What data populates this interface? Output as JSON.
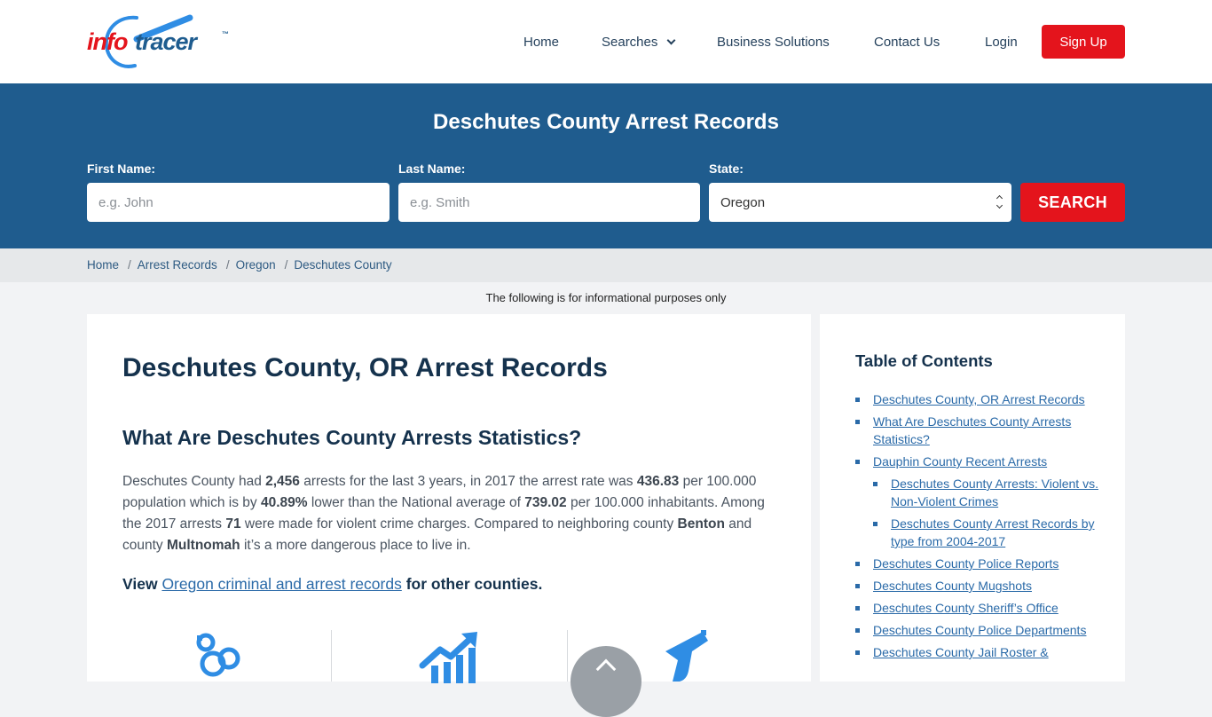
{
  "header": {
    "logo": {
      "part1": "info",
      "part2": "tracer",
      "tm": "™"
    },
    "nav": {
      "home": "Home",
      "searches": "Searches",
      "business": "Business Solutions",
      "contact": "Contact Us",
      "login": "Login",
      "signup": "Sign Up"
    }
  },
  "hero": {
    "title": "Deschutes County Arrest Records",
    "first_name_label": "First Name:",
    "first_name_placeholder": "e.g. John",
    "last_name_label": "Last Name:",
    "last_name_placeholder": "e.g. Smith",
    "state_label": "State:",
    "state_value": "Oregon",
    "search_button": "SEARCH"
  },
  "breadcrumb": [
    "Home",
    "Arrest Records",
    "Oregon",
    "Deschutes County"
  ],
  "info_note": "The following is for informational purposes only",
  "main": {
    "h1": "Deschutes County, OR Arrest Records",
    "h2": "What Are Deschutes County Arrests Statistics?",
    "para": {
      "t1": "Deschutes County had ",
      "arrests": "2,456",
      "t2": " arrests for the last 3 years, in 2017 the arrest rate was ",
      "rate": "436.83",
      "t3": " per 100.000 population which is by ",
      "percent": "40.89%",
      "t4": " lower than the National average of ",
      "national": "739.02",
      "t5": " per 100.000 inhabitants. Among the 2017 arrests ",
      "violent": "71",
      "t6": " were made for violent crime charges. Compared to neighboring county ",
      "county1": "Benton",
      "t7": " and county ",
      "county2": "Multnomah",
      "t8": " it’s a more dangerous place to live in."
    },
    "view": {
      "prefix": "View ",
      "link": "Oregon criminal and arrest records",
      "suffix": " for other counties."
    },
    "stat_icons": [
      "handcuffs-icon",
      "chart-growth-icon",
      "gun-icon"
    ],
    "accent_color": "#2f8de4"
  },
  "sidebar": {
    "title": "Table of Contents",
    "items": [
      {
        "label": "Deschutes County, OR Arrest Records",
        "sub": false
      },
      {
        "label": "What Are Deschutes County Arrests Statistics?",
        "sub": false
      },
      {
        "label": "Dauphin County Recent Arrests",
        "sub": false
      },
      {
        "label": "Deschutes County Arrests: Violent vs. Non-Violent Crimes",
        "sub": true
      },
      {
        "label": "Deschutes County Arrest Records by type from 2004-2017",
        "sub": true
      },
      {
        "label": "Deschutes County Police Reports",
        "sub": false
      },
      {
        "label": "Deschutes County Mugshots",
        "sub": false
      },
      {
        "label": "Deschutes County Sheriff’s Office",
        "sub": false
      },
      {
        "label": "Deschutes County Police Departments",
        "sub": false
      },
      {
        "label": "Deschutes County Jail Roster &",
        "sub": false
      }
    ]
  },
  "colors": {
    "brand_red": "#e4141c",
    "brand_blue": "#1f5c8e",
    "link": "#2a6aa8"
  }
}
